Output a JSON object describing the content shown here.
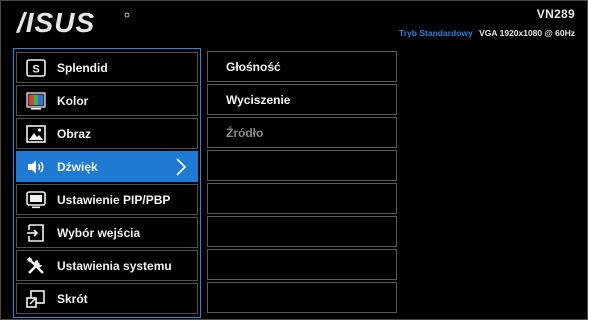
{
  "header": {
    "brand": "ASUS",
    "model": "VN289",
    "mode": "Tryb Standardowy",
    "input": "VGA",
    "resolution": "1920x1080 @ 60Hz"
  },
  "menu": {
    "items": [
      {
        "label": "Splendid",
        "icon": "splendid-icon"
      },
      {
        "label": "Kolor",
        "icon": "color-icon"
      },
      {
        "label": "Obraz",
        "icon": "image-icon"
      },
      {
        "label": "Dźwięk",
        "icon": "speaker-icon",
        "selected": true
      },
      {
        "label": "Ustawienie PIP/PBP",
        "icon": "pip-icon"
      },
      {
        "label": "Wybór wejścia",
        "icon": "input-icon"
      },
      {
        "label": "Ustawienia systemu",
        "icon": "tools-icon"
      },
      {
        "label": "Skrót",
        "icon": "shortcut-icon"
      }
    ]
  },
  "submenu": {
    "items": [
      {
        "label": "Głośność"
      },
      {
        "label": "Wyciszenie"
      },
      {
        "label": "Źródło",
        "disabled": true
      },
      {
        "label": ""
      },
      {
        "label": ""
      },
      {
        "label": ""
      },
      {
        "label": ""
      },
      {
        "label": ""
      }
    ]
  },
  "colors": {
    "accent": "#1f7ad3",
    "mode_text": "#2f7fd6",
    "background": "#000000"
  }
}
